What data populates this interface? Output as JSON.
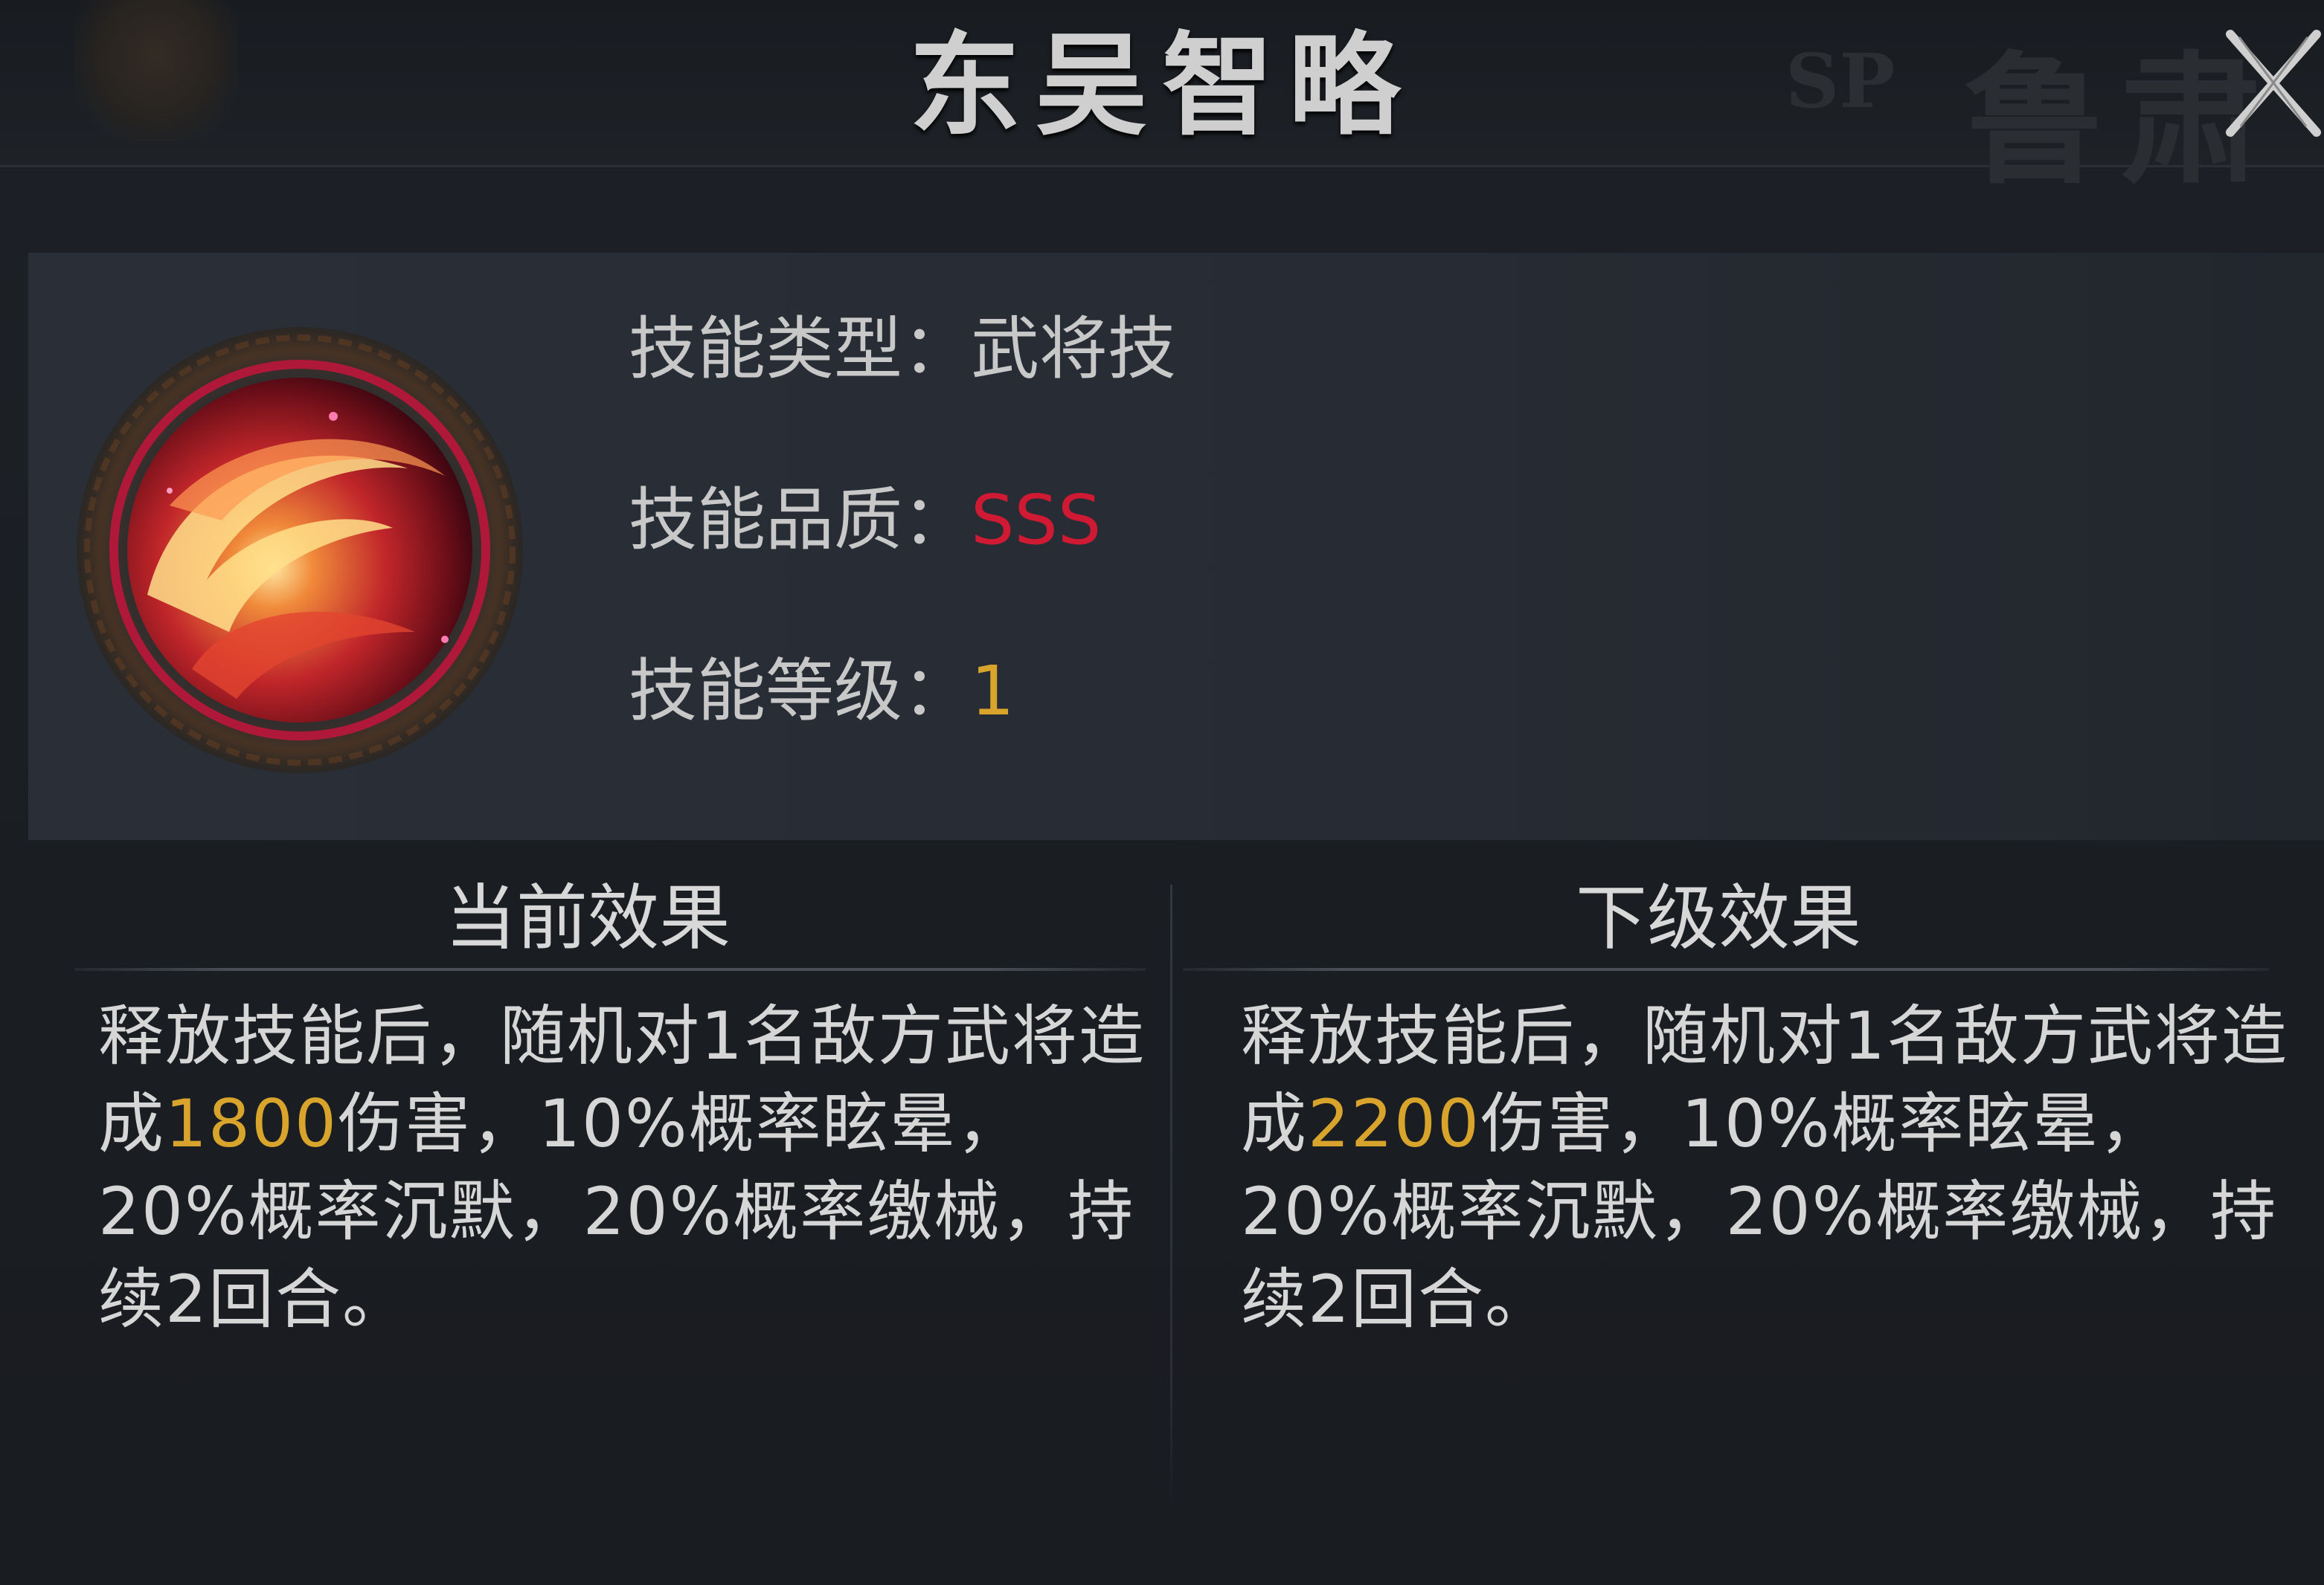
{
  "header": {
    "title": "东吴智略",
    "faded_badge": "SP",
    "faded_name": "鲁肃",
    "close_icon": "close-x-icon"
  },
  "skill": {
    "icon": "red-flame-orb-icon",
    "type_label": "技能类型：",
    "type_value": "武将技",
    "quality_label": "技能品质：",
    "quality_value": "SSS",
    "level_label": "技能等级：",
    "level_value": "1"
  },
  "colors": {
    "quality": "#d01a33",
    "level": "#d8a42b",
    "highlight_number": "#d8a42b"
  },
  "current_effect": {
    "title": "当前效果",
    "text_before": "释放技能后，随机对1名敌方武将造成",
    "damage": "1800",
    "text_after": "伤害，10%概率眩晕，20%概率沉默，20%概率缴械，持续2回合。"
  },
  "next_effect": {
    "title": "下级效果",
    "text_before": "释放技能后，随机对1名敌方武将造成",
    "damage": "2200",
    "text_after": "伤害，10%概率眩晕，20%概率沉默，20%概率缴械，持续2回合。"
  }
}
